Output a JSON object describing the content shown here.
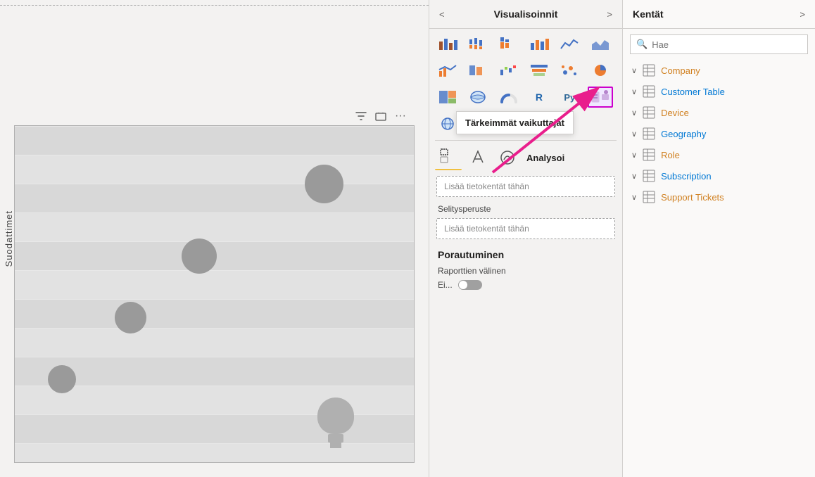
{
  "canvas": {
    "toolbar": {
      "filter_label": "⧉",
      "more_label": "..."
    },
    "side_label": "Suodattimet"
  },
  "viz_panel": {
    "title": "Visualisoinnit",
    "left_arrow": "<",
    "right_arrow": ">",
    "tooltip": "Tärkeimmät vaikuttajat",
    "tab_analyse_label": "Analysoi",
    "field_box1_placeholder": "Lisää tietokentät tähän",
    "field_label1": "Selitysperuste",
    "field_box2_placeholder": "Lisää tietokentät tähän",
    "section_title": "Porautuminen",
    "sub_label": "Raporttien välinen",
    "toggle_text": "Ei..."
  },
  "fields_panel": {
    "title": "Kentät",
    "right_arrow": ">",
    "search_placeholder": "Hae",
    "groups": [
      {
        "name": "Company",
        "color": "orange"
      },
      {
        "name": "Customer Table",
        "color": "blue"
      },
      {
        "name": "Device",
        "color": "orange"
      },
      {
        "name": "Geography",
        "color": "blue"
      },
      {
        "name": "Role",
        "color": "orange"
      },
      {
        "name": "Subscription",
        "color": "blue"
      },
      {
        "name": "Support Tickets",
        "color": "orange"
      }
    ]
  }
}
